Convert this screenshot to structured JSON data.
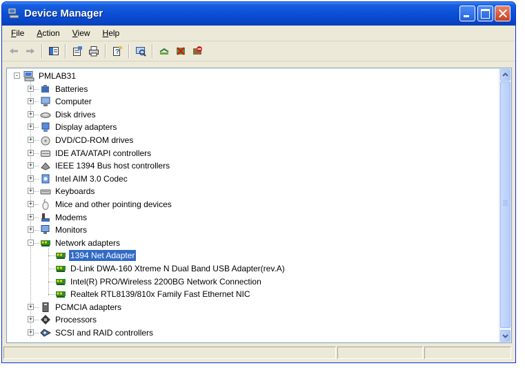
{
  "window": {
    "title": "Device Manager"
  },
  "menu": [
    {
      "label": "File"
    },
    {
      "label": "Action"
    },
    {
      "label": "View"
    },
    {
      "label": "Help"
    }
  ],
  "toolbar": {
    "tools": [
      "back-icon",
      "forward-icon",
      "|",
      "show-hide-tree-icon",
      "|",
      "properties-icon",
      "print-icon",
      "|",
      "help-icon",
      "|",
      "scan-hardware-icon",
      "|",
      "update-driver-icon",
      "uninstall-icon",
      "disable-icon"
    ]
  },
  "tree": {
    "root": {
      "label": "PMLAB31"
    },
    "categories": [
      {
        "label": "Batteries",
        "icon": "battery-icon"
      },
      {
        "label": "Computer",
        "icon": "computer-icon"
      },
      {
        "label": "Disk drives",
        "icon": "disk-drive-icon"
      },
      {
        "label": "Display adapters",
        "icon": "display-adapter-icon"
      },
      {
        "label": "DVD/CD-ROM drives",
        "icon": "dvd-drive-icon"
      },
      {
        "label": "IDE ATA/ATAPI controllers",
        "icon": "ide-controller-icon"
      },
      {
        "label": "IEEE 1394 Bus host controllers",
        "icon": "ieee1394-icon"
      },
      {
        "label": "Intel AIM 3.0 Codec",
        "icon": "codec-icon"
      },
      {
        "label": "Keyboards",
        "icon": "keyboard-icon"
      },
      {
        "label": "Mice and other pointing devices",
        "icon": "mouse-icon"
      },
      {
        "label": "Modems",
        "icon": "modem-icon"
      },
      {
        "label": "Monitors",
        "icon": "monitor-icon"
      },
      {
        "label": "Network adapters",
        "icon": "network-adapter-icon",
        "expanded": true
      }
    ],
    "network_children": [
      {
        "label": "1394 Net Adapter",
        "selected": true
      },
      {
        "label": "D-Link DWA-160 Xtreme N Dual Band USB Adapter(rev.A)"
      },
      {
        "label": "Intel(R) PRO/Wireless 2200BG Network Connection"
      },
      {
        "label": "Realtek RTL8139/810x Family Fast Ethernet NIC"
      }
    ],
    "after": [
      {
        "label": "PCMCIA adapters",
        "icon": "pcmcia-icon"
      },
      {
        "label": "Processors",
        "icon": "processor-icon"
      },
      {
        "label": "SCSI and RAID controllers",
        "icon": "scsi-controller-icon"
      }
    ]
  },
  "colors": {
    "titlebar": "#0a50d6",
    "selection": "#316ac5",
    "chrome": "#ece9d8"
  }
}
